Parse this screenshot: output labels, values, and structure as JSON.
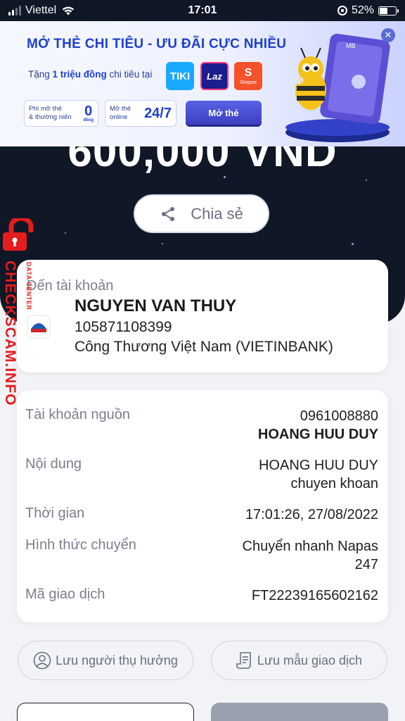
{
  "status_bar": {
    "carrier": "Viettel",
    "time": "17:01",
    "battery": "52%",
    "battery_level": 0.52
  },
  "ad": {
    "title": "MỞ THẺ CHI TIÊU - ƯU ĐÃI CỰC NHIỀU",
    "subtitle_pre": "Tặng ",
    "subtitle_bold": "1 triệu đồng",
    "subtitle_post": " chi tiêu tại",
    "merchants": [
      "TIKI",
      "Laz",
      "Shopee"
    ],
    "fee_label_1": "Phí mở thẻ",
    "fee_label_2": "& thường niên",
    "fee_value": "0",
    "fee_unit": "đồng",
    "online_label_1": "Mở thẻ",
    "online_label_2": "online",
    "online_value": "24/7",
    "open_button": "Mở thẻ",
    "close": "✕",
    "card_brand": "MB"
  },
  "amount": "600,000 VND",
  "share_label": "Chia sẻ",
  "destination": {
    "label": "Đến tài khoản",
    "name": "NGUYEN VAN THUY",
    "account": "105871108399",
    "bank": "Công Thương Việt Nam (VIETINBANK)"
  },
  "details": {
    "source_label": "Tài khoản nguồn",
    "source_account": "0961008880",
    "source_name": "HOANG HUU DUY",
    "content_label": "Nội dung",
    "content_line1": "HOANG HUU DUY",
    "content_line2": "chuyen khoan",
    "time_label": "Thời gian",
    "time_value": "17:01:26, 27/08/2022",
    "method_label": "Hình thức chuyển",
    "method_line1": "Chuyển nhanh Napas",
    "method_line2": "247",
    "txn_label": "Mã giao dịch",
    "txn_value": "FT22239165602162"
  },
  "actions": {
    "save_recipient": "Lưu người thụ hưởng",
    "save_template": "Lưu mẫu giao dịch"
  },
  "watermark": {
    "main": "CHECKSCAM.INFO",
    "sub": "DATA CENTER"
  },
  "colors": {
    "dark_bg": "#101726",
    "accent_blue": "#1d3fcf",
    "watermark_red": "#e21d1d"
  }
}
